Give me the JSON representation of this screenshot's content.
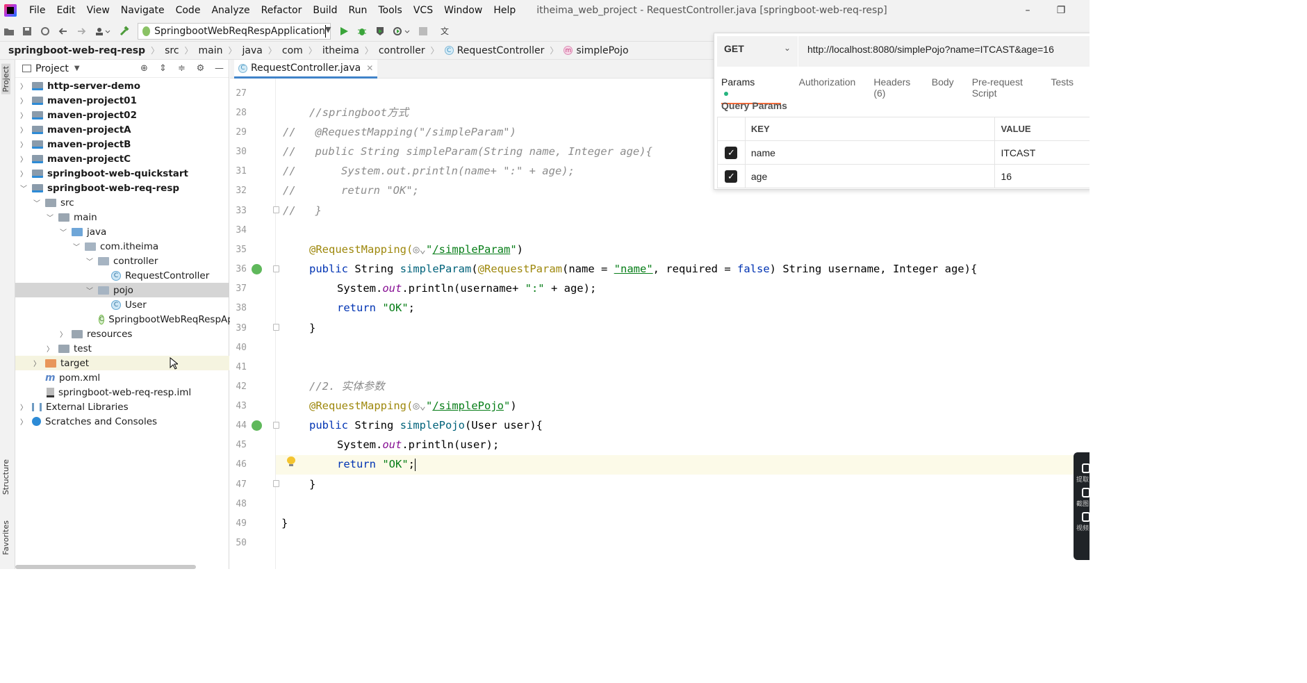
{
  "window": {
    "menu": [
      "File",
      "Edit",
      "View",
      "Navigate",
      "Code",
      "Analyze",
      "Refactor",
      "Build",
      "Run",
      "Tools",
      "VCS",
      "Window",
      "Help"
    ],
    "title": "itheima_web_project - RequestController.java [springboot-web-req-resp]",
    "minimize": "–",
    "restore": "❐"
  },
  "toolbar": {
    "run_config": "SpringbootWebReqRespApplication"
  },
  "breadcrumb": [
    "springboot-web-req-resp",
    "src",
    "main",
    "java",
    "com",
    "itheima",
    "controller",
    "RequestController",
    "simplePojo"
  ],
  "sidebar": {
    "project_tab": "Project",
    "structure_tab": "Structure",
    "favorites_tab": "Favorites"
  },
  "project": {
    "title": "Project",
    "tree": [
      {
        "label": "http-server-demo",
        "bold": true
      },
      {
        "label": "maven-project01",
        "bold": true
      },
      {
        "label": "maven-project02",
        "bold": true
      },
      {
        "label": "maven-projectA",
        "bold": true
      },
      {
        "label": "maven-projectB",
        "bold": true
      },
      {
        "label": "maven-projectC",
        "bold": true
      },
      {
        "label": "springboot-web-quickstart",
        "bold": true
      },
      {
        "label": "springboot-web-req-resp",
        "bold": true
      },
      {
        "label": "src"
      },
      {
        "label": "main"
      },
      {
        "label": "java"
      },
      {
        "label": "com.itheima"
      },
      {
        "label": "controller"
      },
      {
        "label": "RequestController"
      },
      {
        "label": "pojo"
      },
      {
        "label": "User"
      },
      {
        "label": "SpringbootWebReqRespAp"
      },
      {
        "label": "resources"
      },
      {
        "label": "test"
      },
      {
        "label": "target"
      },
      {
        "label": "pom.xml"
      },
      {
        "label": "springboot-web-req-resp.iml"
      },
      {
        "label": "External Libraries"
      },
      {
        "label": "Scratches and Consoles"
      }
    ]
  },
  "editor": {
    "tab": "RequestController.java",
    "line_numbers": [
      "27",
      "28",
      "29",
      "30",
      "31",
      "32",
      "33",
      "34",
      "35",
      "36",
      "37",
      "38",
      "39",
      "40",
      "41",
      "42",
      "43",
      "44",
      "45",
      "46",
      "47",
      "48",
      "49",
      "50"
    ],
    "lines": {
      "l28": "//springboot方式",
      "l29a": "//",
      "l29b": "@RequestMapping(\"/simpleParam\")",
      "l30a": "//",
      "l30b": "public String simpleParam(String name, Integer age){",
      "l31a": "//",
      "l31b": "System.out.println(name+ \":\" + age);",
      "l32a": "//",
      "l32b": "return \"OK\";",
      "l33a": "//",
      "l33b": "}",
      "l35_anno": "@RequestMapping(",
      "l35_path": "/simpleParam",
      "l36_pub": "public",
      "l36_type": "String",
      "l36_fn": "simpleParam",
      "l36_anno": "@RequestParam",
      "l36_name_eq": "(name = ",
      "l36_name": "\"name\"",
      "l36_req": ", required = ",
      "l36_false": "false",
      "l36_rest": ") String username, Integer age){",
      "l37_a": "System.",
      "l37_out": "out",
      "l37_b": ".println(username+ ",
      "l37_str": "\":\"",
      "l37_c": " + age);",
      "l38_ret": "return",
      "l38_ok": "\"OK\"",
      "l39": "}",
      "l42": "//2. 实体参数",
      "l43_anno": "@RequestMapping(",
      "l43_path": "/simplePojo",
      "l44_pub": "public",
      "l44_type": "String",
      "l44_fn": "simplePojo",
      "l44_rest": "(User user){",
      "l45_a": "System.",
      "l45_out": "out",
      "l45_b": ".println(user);",
      "l46_ret": "return",
      "l46_ok": "\"OK\"",
      "l47": "}",
      "l49": "}"
    }
  },
  "postman": {
    "method": "GET",
    "url": "http://localhost:8080/simplePojo?name=ITCAST&age=16",
    "tabs": [
      "Params",
      "Authorization",
      "Headers (6)",
      "Body",
      "Pre-request Script",
      "Tests"
    ],
    "section": "Query Params",
    "columns": [
      "KEY",
      "VALUE"
    ],
    "rows": [
      {
        "key": "name",
        "value": "ITCAST"
      },
      {
        "key": "age",
        "value": "16"
      }
    ]
  },
  "float_widget": {
    "labels": [
      "提取",
      "截图",
      "视频"
    ]
  },
  "colors": {
    "accent": "#4083c9",
    "postman_orange": "#ff6c37",
    "params_dot": "#26b47f"
  }
}
